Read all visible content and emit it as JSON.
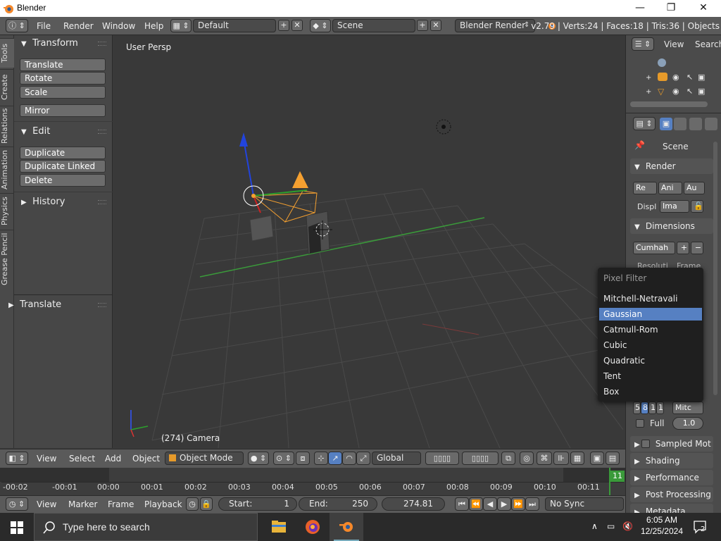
{
  "window": {
    "title": "Blender",
    "minimize": "—",
    "maximize": "❐",
    "close": "✕"
  },
  "infobar": {
    "menus": [
      "File",
      "Render",
      "Window",
      "Help"
    ],
    "layout": "Default",
    "scene": "Scene",
    "engine": "Blender Render",
    "stats": "v2.79 | Verts:24 | Faces:18 | Tris:36 | Objects"
  },
  "vtabs": [
    "Tools",
    "Create",
    "Relations",
    "Animation",
    "Physics",
    "Grease Pencil"
  ],
  "toolshelf": {
    "transform_title": "Transform",
    "transform_buttons": [
      "Translate",
      "Rotate",
      "Scale"
    ],
    "mirror": "Mirror",
    "edit_title": "Edit",
    "edit_buttons": [
      "Duplicate",
      "Duplicate Linked",
      "Delete"
    ],
    "history_title": "History",
    "operator_title": "Translate"
  },
  "viewport": {
    "view_name": "User Persp",
    "object_label": "(274) Camera"
  },
  "outliner": {
    "view": "View",
    "search": "Search"
  },
  "properties": {
    "scene_label": "Scene",
    "render_title": "Render",
    "render_buttons": [
      "Re",
      "Ani",
      "Au"
    ],
    "display_label": "Displ",
    "display_value": "Ima",
    "dimensions_title": "Dimensions",
    "preset_value": "Cumhah",
    "resolution_label": "Resoluti",
    "frame_label": "Frame",
    "samples": [
      "5",
      "8",
      "1",
      "1"
    ],
    "filter_value": "Mitc",
    "full_label": "Full",
    "filter_size": "1.0",
    "sampled_motion": "Sampled Mot",
    "shading": "Shading",
    "performance": "Performance",
    "post_processing": "Post Processing",
    "metadata": "Metadata"
  },
  "pixel_menu": {
    "title": "Pixel Filter",
    "items": [
      "Mitchell-Netravali",
      "Gaussian",
      "Catmull-Rom",
      "Cubic",
      "Quadratic",
      "Tent",
      "Box"
    ],
    "selected": "Gaussian"
  },
  "header3d": {
    "menus": [
      "View",
      "Select",
      "Add",
      "Object"
    ],
    "mode": "Object Mode",
    "orientation": "Global"
  },
  "timeline": {
    "ticks": [
      "-00:02",
      "-00:01",
      "00:00",
      "00:01",
      "00:02",
      "00:03",
      "00:04",
      "00:05",
      "00:06",
      "00:07",
      "00:08",
      "00:09",
      "00:10",
      "00:11"
    ],
    "current_badge": "11",
    "menus": [
      "View",
      "Marker",
      "Frame",
      "Playback"
    ],
    "start_label": "Start:",
    "start_value": "1",
    "end_label": "End:",
    "end_value": "250",
    "current_frame": "274.81",
    "sync": "No Sync"
  },
  "taskbar": {
    "search_placeholder": "Type here to search",
    "time": "6:05 AM",
    "date": "12/25/2024",
    "notification_count": "2"
  },
  "colors": {
    "accent_orange": "#f5a030",
    "selection_blue": "#5680c2",
    "grid_green": "#3a9a3a"
  }
}
